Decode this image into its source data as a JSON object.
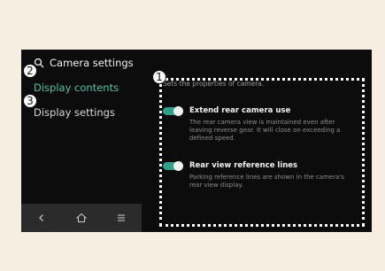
{
  "header": {
    "title": "Camera settings",
    "icon": "search-icon"
  },
  "sidebar": {
    "items": [
      {
        "label": "Display contents",
        "active": true
      },
      {
        "label": "Display settings",
        "active": false
      }
    ]
  },
  "nav": {
    "back_icon": "chevron-left-icon",
    "home_icon": "home-icon",
    "menu_icon": "menu-icon"
  },
  "content": {
    "description": "Sets the properties of camera.",
    "settings": [
      {
        "title": "Extend rear camera use",
        "subtitle": "The rear camera view is maintained even after leaving reverse gear. It will close on exceeding a defined speed.",
        "enabled": true
      },
      {
        "title": "Rear view reference lines",
        "subtitle": "Parking reference lines are shown in the camera's rear view display.",
        "enabled": true
      }
    ]
  },
  "markers": [
    "1",
    "2",
    "3"
  ],
  "colors": {
    "accent": "#2fa08a",
    "active_text": "#4ec3a9",
    "page_background": "#f6eee0",
    "screen_background": "#0c0c0c"
  }
}
